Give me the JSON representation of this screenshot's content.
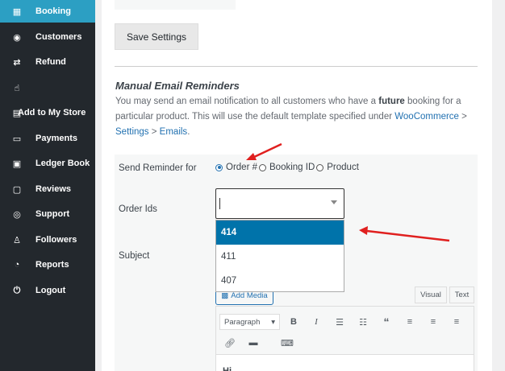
{
  "sidebar": {
    "items": [
      {
        "label": "Booking",
        "icon": "booking-icon",
        "glyph": "▦",
        "active": true
      },
      {
        "label": "Customers",
        "icon": "customers-icon",
        "glyph": "◉"
      },
      {
        "label": "Refund",
        "icon": "refund-icon",
        "glyph": "⇄"
      },
      {
        "label": "",
        "icon": "pointer-icon",
        "glyph": "☝"
      },
      {
        "label": "Add to My Store",
        "icon": "store-icon",
        "glyph": "▤"
      },
      {
        "label": "Payments",
        "icon": "payments-icon",
        "glyph": "▭"
      },
      {
        "label": "Ledger Book",
        "icon": "ledger-icon",
        "glyph": "▣"
      },
      {
        "label": "Reviews",
        "icon": "reviews-icon",
        "glyph": "▢"
      },
      {
        "label": "Support",
        "icon": "support-icon",
        "glyph": "◎"
      },
      {
        "label": "Followers",
        "icon": "followers-icon",
        "glyph": "♙"
      },
      {
        "label": "Reports",
        "icon": "reports-icon",
        "glyph": "◔"
      },
      {
        "label": "Logout",
        "icon": "logout-icon",
        "glyph": "⏻"
      }
    ]
  },
  "settings": {
    "save_label": "Save Settings"
  },
  "reminders": {
    "title": "Manual Email Reminders",
    "desc_part1": "You may send an email notification to all customers who have a ",
    "desc_bold": "future",
    "desc_part2": " booking for a particular product. This will use the default template specified under ",
    "link1": "WooCommerce",
    "sep1": " > ",
    "link2": "Settings",
    "sep2": " > ",
    "link3": "Emails",
    "desc_end": ".",
    "send_label": "Send Reminder for",
    "radio_options": [
      "Order #",
      "Booking ID",
      "Product"
    ],
    "radio_selected": "Order #",
    "order_ids_label": "Order Ids",
    "subject_label": "Subject",
    "order_options": [
      "414",
      "411",
      "407"
    ],
    "order_highlighted": "414",
    "add_media_label": "Add Media",
    "tab_visual": "Visual",
    "tab_text": "Text",
    "format_select": "Paragraph",
    "editor_hint": "Hi"
  },
  "colors": {
    "accent": "#2c9fc3",
    "sidebar_bg": "#23282d",
    "highlight": "#0073aa",
    "arrow": "#e0201f"
  }
}
